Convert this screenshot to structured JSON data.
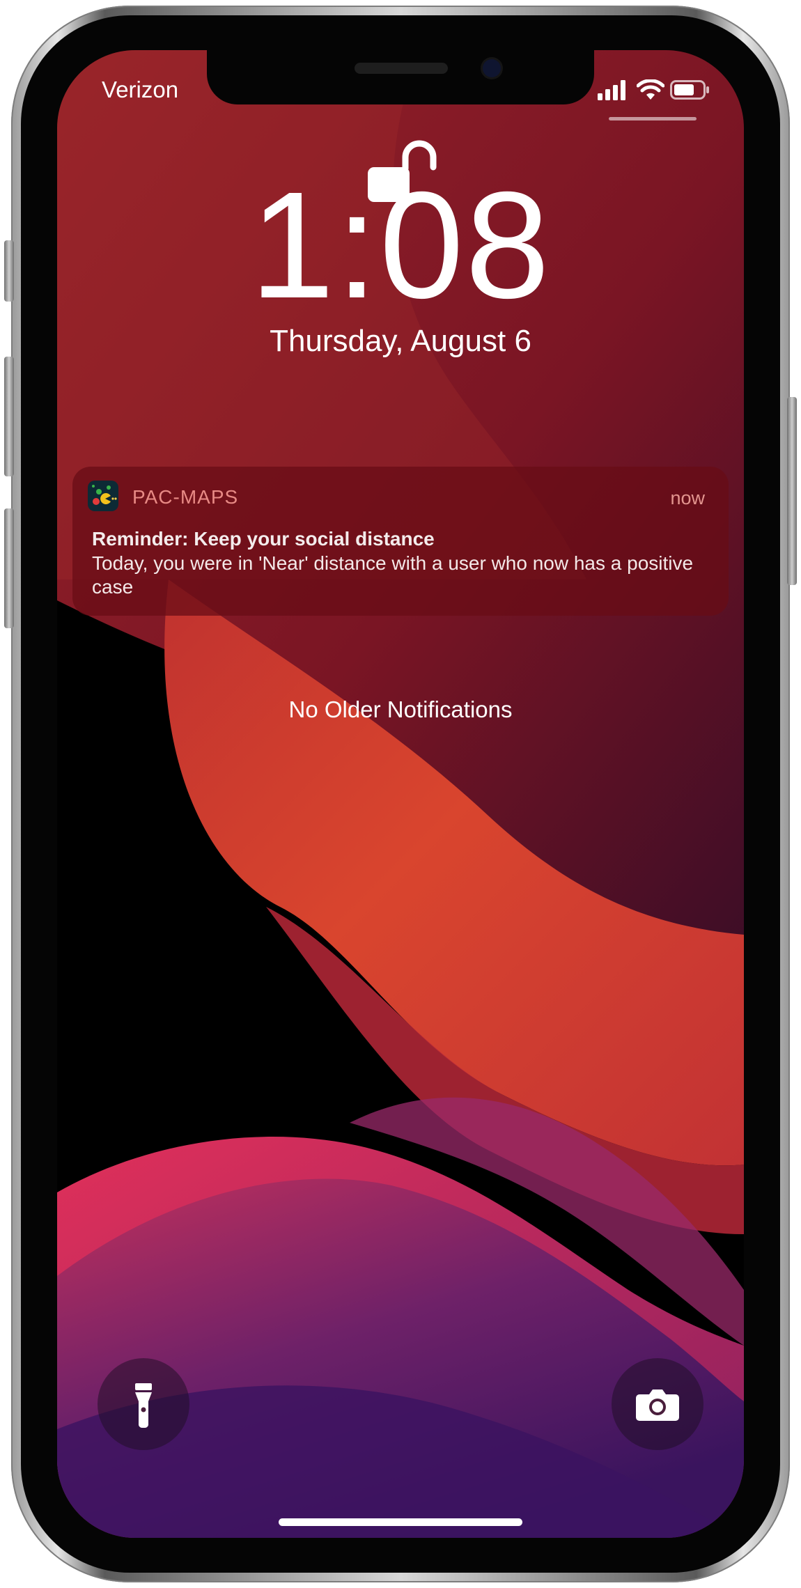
{
  "status_bar": {
    "carrier": "Verizon",
    "signal_icon": "cellular-signal-icon",
    "wifi_icon": "wifi-icon",
    "battery_icon": "battery-icon"
  },
  "lock_screen": {
    "lock_icon": "unlocked-padlock-icon",
    "time": "1:08",
    "date": "Thursday, August 6"
  },
  "notification": {
    "app_name": "PAC-MAPS",
    "time": "now",
    "title": "Reminder: Keep your social distance",
    "body": "Today, you were in 'Near' distance with a user who now has a positive case"
  },
  "no_older_label": "No Older Notifications",
  "quick_actions": {
    "flashlight_icon": "flashlight-icon",
    "camera_icon": "camera-icon"
  },
  "colors": {
    "notification_bg": "#680c16",
    "app_name": "#e88a85",
    "wallpaper_red": "#8e1a26",
    "wallpaper_orange": "#d9402d",
    "wallpaper_purple": "#4a1a6a"
  }
}
